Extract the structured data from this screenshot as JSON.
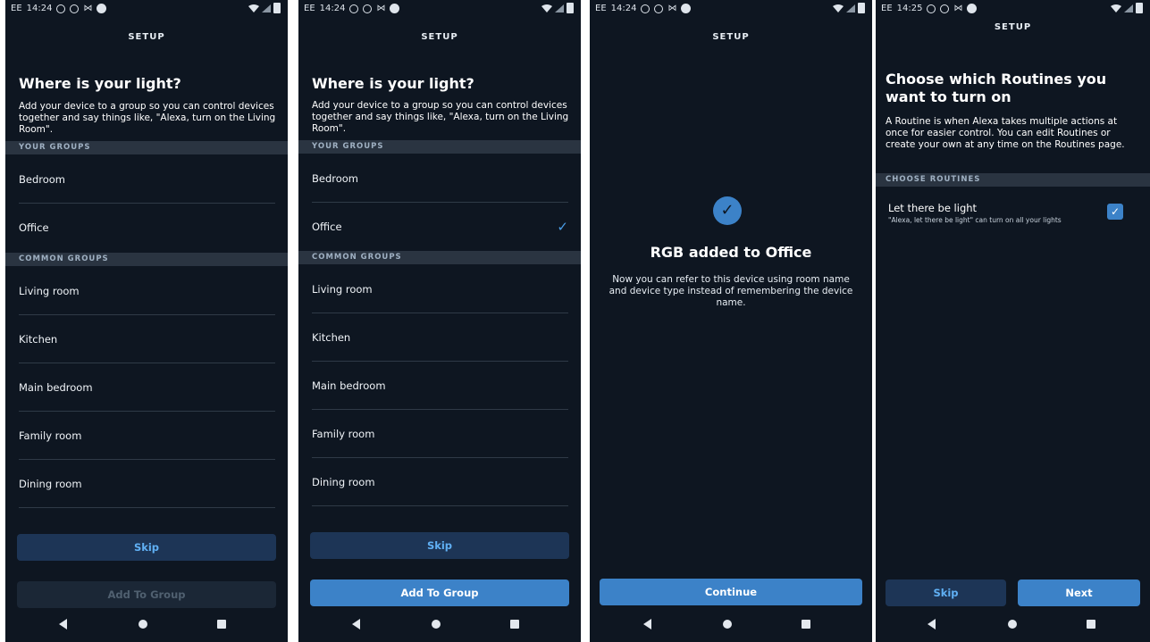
{
  "status_bar": {
    "carrier": "EE",
    "time1": "14:24",
    "time4": "14:25",
    "mail_glyph": "⋈"
  },
  "icons": {
    "status": [
      "circle-outline-icon",
      "circle-outline-icon",
      "mail-icon",
      "circle-filled-icon",
      "wifi-icon",
      "signal-icon",
      "battery-icon"
    ],
    "nav": [
      "back-icon",
      "home-icon",
      "recents-icon"
    ],
    "check_glyph": "✓"
  },
  "colors": {
    "background": "#0e1621",
    "accent": "#3c82c8",
    "section": "#2a3441",
    "secondary_button": "#1d3556",
    "link_blue": "#60b0f4"
  },
  "header": {
    "title": "SETUP"
  },
  "group_screen": {
    "title": "Where is your light?",
    "description": "Add your device to a group so you can control devices together and say things like, \"Alexa, turn on the Living Room\".",
    "your_groups_header": "YOUR GROUPS",
    "your_groups": [
      "Bedroom",
      "Office"
    ],
    "common_groups_header": "COMMON GROUPS",
    "common_groups": [
      "Living room",
      "Kitchen",
      "Main bedroom",
      "Family room",
      "Dining room"
    ],
    "skip_label": "Skip",
    "add_label": "Add To Group"
  },
  "screen1": {
    "add_enabled": false,
    "selected": null
  },
  "screen2": {
    "add_enabled": true,
    "selected": "Office"
  },
  "screen3": {
    "title": "RGB added to Office",
    "description": "Now you can refer to this device using room name and device type instead of remembering the device name.",
    "continue_label": "Continue"
  },
  "screen4": {
    "title": "Choose which Routines you want to turn on",
    "description": "A Routine is when Alexa takes multiple actions at once for easier control. You can edit Routines or create your own at any time on the Routines page.",
    "section_header": "CHOOSE ROUTINES",
    "routine": {
      "name": "Let there be light",
      "subtitle": "\"Alexa, let there be light\" can turn on all your lights",
      "checked": true
    },
    "skip_label": "Skip",
    "next_label": "Next"
  }
}
